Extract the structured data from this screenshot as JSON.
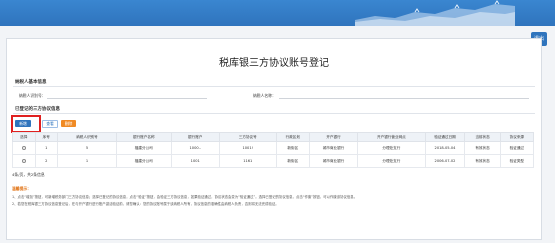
{
  "header": {
    "exit_label": "退出"
  },
  "page": {
    "title": "税库银三方协议账号登记"
  },
  "taxpayer_section": {
    "title": "纳税人基本信息",
    "taxpayer_id_label": "纳税人识别号：",
    "taxpayer_name_label": "纳税人名称："
  },
  "registered_section": {
    "title": "已登记的三方协议信息"
  },
  "toolbar": {
    "add_label": "新增",
    "view_label": "查看",
    "delete_label": "删除"
  },
  "table": {
    "headers": [
      "选择",
      "序号",
      "纳税人识别号",
      "银行账户名称",
      "银行账户",
      "三方协议号",
      "行政区划",
      "开户银行",
      "开户银行营业网点",
      "验证通过日期",
      "当前状态",
      "协议来源"
    ],
    "rows": [
      {
        "seq": "1",
        "taxpayer_id": "5",
        "account_name": "福建分公司",
        "account": "1000..",
        "agreement_no": "1001!",
        "region": "新街区",
        "bank": "城市商业银行",
        "branch": "分理处支行",
        "date": "2018-05-04",
        "status": "有效状态",
        "source": "验证通过"
      },
      {
        "seq": "2",
        "taxpayer_id": "1",
        "account_name": "福建分公司",
        "account": "1001",
        "agreement_no": "1161",
        "region": "新街区",
        "bank": "城市商业银行",
        "branch": "分理处支行",
        "date": "2006-07-02",
        "status": "有效状态",
        "source": "验证类型"
      }
    ]
  },
  "pager": {
    "text": "4条/页，共2条信息"
  },
  "tips": {
    "title": "温馨提示：",
    "line1": "1、点击“增加”按钮，可新增税务部门三方协议信息；选择已登记的协议信息，点击“验证”按钮，会验证三方协议信息，如果验证通过，协议状态会变为“验证通过”。选择已登记的协议信息，点击“作废”按钮，可以作废该协议信息。",
    "line2": "2、若您在税库银三方协议信息登记后，在与开户银行进行账户激活验证前，请您确认：您的协议账号属于该纳税人所有，协议信息的准确性由纳税人负责，否则将无法完成验证。"
  }
}
